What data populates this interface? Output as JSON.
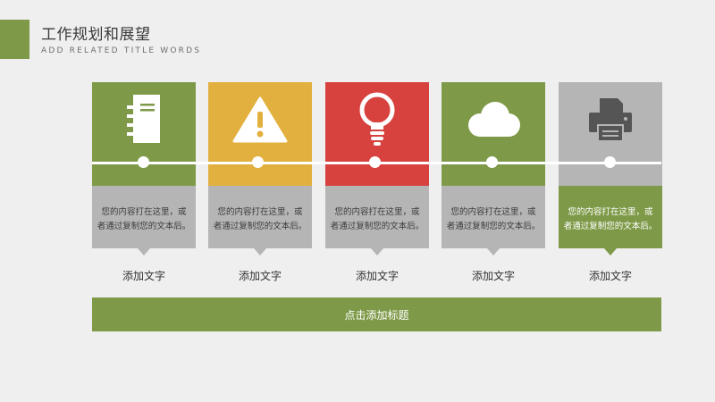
{
  "header": {
    "title": "工作规划和展望",
    "subtitle": "ADD RELATED TITLE WORDS"
  },
  "colors": {
    "green": "#7e9a48",
    "yellow": "#e2b03e",
    "red": "#d7423e",
    "gray": "#b5b5b5",
    "background": "#efefef"
  },
  "cards": [
    {
      "icon": "notebook-icon",
      "top_color": "#7e9a48",
      "bottom_color": "#b5b5b5",
      "desc_line1": "您的内容打在这里，或",
      "desc_line2": "者通过复制您的文本后。",
      "label": "添加文字"
    },
    {
      "icon": "warning-icon",
      "top_color": "#e2b03e",
      "bottom_color": "#b5b5b5",
      "desc_line1": "您的内容打在这里，或",
      "desc_line2": "者通过复制您的文本后。",
      "label": "添加文字"
    },
    {
      "icon": "lightbulb-icon",
      "top_color": "#d7423e",
      "bottom_color": "#b5b5b5",
      "desc_line1": "您的内容打在这里，或",
      "desc_line2": "者通过复制您的文本后。",
      "label": "添加文字"
    },
    {
      "icon": "cloud-icon",
      "top_color": "#7e9a48",
      "bottom_color": "#b5b5b5",
      "desc_line1": "您的内容打在这里，或",
      "desc_line2": "者通过复制您的文本后。",
      "label": "添加文字"
    },
    {
      "icon": "printer-icon",
      "top_color": "#b5b5b5",
      "bottom_color": "#7e9a48",
      "desc_line1": "您的内容打在这里，或",
      "desc_line2": "者通过复制您的文本后。",
      "label": "添加文字"
    }
  ],
  "footer": {
    "button_label": "点击添加标题"
  }
}
